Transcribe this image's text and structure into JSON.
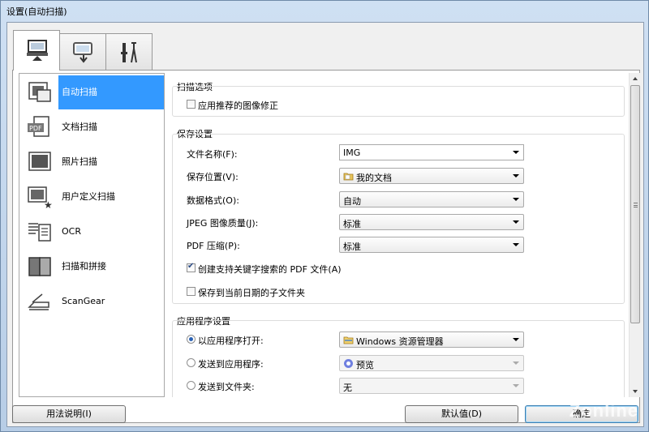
{
  "window": {
    "title": "设置(自动扫描)"
  },
  "tabs": [
    {
      "icon": "scan-from-computer-icon",
      "active": true
    },
    {
      "icon": "scan-from-panel-icon",
      "active": false
    },
    {
      "icon": "general-settings-tools-icon",
      "active": false
    }
  ],
  "nav": {
    "items": [
      {
        "label": "自动扫描",
        "icon": "auto-scan-icon",
        "selected": true
      },
      {
        "label": "文档扫描",
        "icon": "pdf-document-icon",
        "selected": false
      },
      {
        "label": "照片扫描",
        "icon": "photo-icon",
        "selected": false
      },
      {
        "label": "用户定义扫描",
        "icon": "custom-scan-icon",
        "selected": false
      },
      {
        "label": "OCR",
        "icon": "ocr-text-icon",
        "selected": false
      },
      {
        "label": "扫描和拼接",
        "icon": "stitch-icon",
        "selected": false
      },
      {
        "label": "ScanGear",
        "icon": "scangear-icon",
        "selected": false
      }
    ]
  },
  "scan_options": {
    "title": "扫描选项",
    "recommended_correction": {
      "label": "应用推荐的图像修正",
      "checked": false
    }
  },
  "save_settings": {
    "title": "保存设置",
    "file_name": {
      "label": "文件名称(F):",
      "value": "IMG"
    },
    "save_location": {
      "label": "保存位置(V):",
      "value": "我的文档"
    },
    "data_format": {
      "label": "数据格式(O):",
      "value": "自动"
    },
    "jpeg_quality": {
      "label": "JPEG 图像质量(J):",
      "value": "标准"
    },
    "pdf_compression": {
      "label": "PDF 压缩(P):",
      "value": "标准"
    },
    "keyword_pdf": {
      "label": "创建支持关键字搜索的 PDF 文件(A)",
      "checked": true
    },
    "date_subfolder": {
      "label": "保存到当前日期的子文件夹",
      "checked": false
    }
  },
  "app_settings": {
    "title": "应用程序设置",
    "open_with": {
      "label": "以应用程序打开:",
      "value": "Windows 资源管理器",
      "checked": true
    },
    "send_to_app": {
      "label": "发送到应用程序:",
      "value": "预览",
      "checked": false
    },
    "send_to_folder": {
      "label": "发送到文件夹:",
      "value": "无",
      "checked": false
    }
  },
  "buttons": {
    "help": "用法说明(I)",
    "defaults": "默认值(D)",
    "ok": "确定"
  },
  "watermark": "Zonline",
  "colors": {
    "selection": "#3399ff",
    "window_frame": "#b9d1ea"
  }
}
